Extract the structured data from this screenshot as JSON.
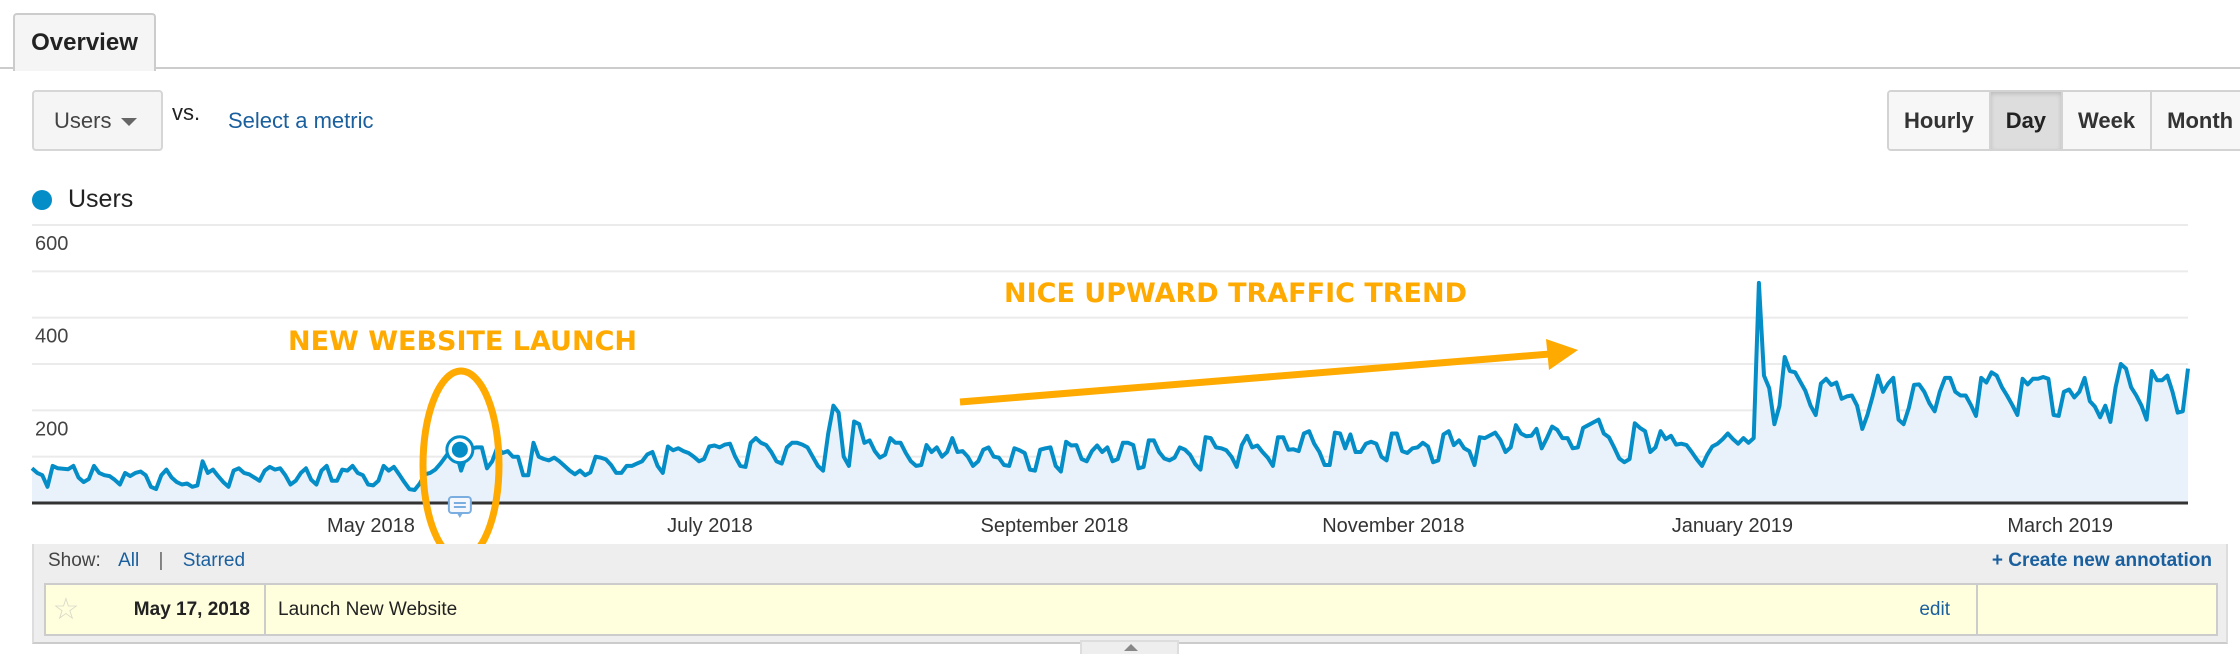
{
  "tabs": [
    {
      "label": "Overview",
      "active": true
    }
  ],
  "metric_selector": {
    "value": "Users",
    "vs_label": "vs.",
    "secondary_link": "Select a metric"
  },
  "time_buttons": [
    {
      "label": "Hourly",
      "active": false
    },
    {
      "label": "Day",
      "active": true
    },
    {
      "label": "Week",
      "active": false
    },
    {
      "label": "Month",
      "active": false
    }
  ],
  "legend": {
    "label": "Users",
    "color": "#058dc7"
  },
  "callouts": {
    "launch": "NEW WEBSITE LAUNCH",
    "trend": "NICE UPWARD TRAFFIC TREND",
    "color": "#ffaa00"
  },
  "annotations": {
    "show_label": "Show:",
    "filter_all": "All",
    "filter_separator": "|",
    "filter_starred": "Starred",
    "create_label": "+ Create new annotation",
    "items": [
      {
        "date": "May 17, 2018",
        "text": "Launch New Website",
        "edit_label": "edit",
        "starred": false
      }
    ]
  },
  "chart_data": {
    "type": "area",
    "title": "",
    "series": [
      {
        "name": "Users",
        "color": "#058dc7"
      }
    ],
    "ylim": [
      0,
      600
    ],
    "yticks": [
      200,
      400,
      600
    ],
    "xtick_labels": [
      "May 2018",
      "July 2018",
      "September 2018",
      "November 2018",
      "January 2019",
      "March 2019"
    ],
    "grid": true,
    "start_date": "2018-03-01",
    "end_date": "2019-03-24",
    "highlight_point": {
      "date": "2018-05-17",
      "value": 115
    },
    "values": [
      75,
      65,
      60,
      35,
      80,
      75,
      74,
      73,
      80,
      55,
      45,
      52,
      80,
      65,
      60,
      58,
      50,
      40,
      65,
      58,
      65,
      68,
      60,
      35,
      30,
      60,
      72,
      55,
      45,
      40,
      42,
      35,
      38,
      90,
      65,
      72,
      58,
      45,
      35,
      70,
      75,
      65,
      62,
      55,
      48,
      70,
      78,
      72,
      75,
      60,
      40,
      48,
      65,
      75,
      50,
      40,
      70,
      80,
      48,
      48,
      72,
      70,
      80,
      65,
      60,
      40,
      38,
      48,
      80,
      70,
      78,
      62,
      45,
      30,
      28,
      42,
      62,
      65,
      72,
      85,
      100,
      115,
      110,
      70,
      102,
      118,
      120,
      120,
      75,
      90,
      120,
      108,
      112,
      100,
      100,
      60,
      60,
      130,
      100,
      95,
      92,
      98,
      90,
      80,
      70,
      62,
      70,
      60,
      66,
      100,
      98,
      94,
      82,
      65,
      65,
      80,
      80,
      85,
      90,
      105,
      110,
      80,
      65,
      122,
      114,
      118,
      112,
      108,
      100,
      90,
      95,
      122,
      124,
      120,
      126,
      128,
      100,
      80,
      78,
      130,
      140,
      130,
      125,
      110,
      90,
      85,
      120,
      130,
      130,
      126,
      120,
      100,
      80,
      70,
      150,
      210,
      195,
      100,
      80,
      176,
      170,
      130,
      135,
      112,
      98,
      104,
      140,
      130,
      130,
      108,
      90,
      80,
      82,
      125,
      110,
      120,
      100,
      110,
      140,
      110,
      112,
      100,
      80,
      90,
      115,
      120,
      100,
      98,
      82,
      80,
      118,
      114,
      108,
      72,
      70,
      115,
      118,
      120,
      80,
      68,
      132,
      124,
      125,
      95,
      90,
      112,
      124,
      110,
      120,
      90,
      95,
      130,
      130,
      125,
      75,
      78,
      135,
      135,
      110,
      96,
      92,
      98,
      120,
      115,
      104,
      84,
      72,
      142,
      140,
      120,
      118,
      114,
      100,
      78,
      125,
      145,
      120,
      124,
      110,
      98,
      80,
      142,
      142,
      115,
      116,
      112,
      150,
      155,
      128,
      110,
      82,
      82,
      152,
      150,
      118,
      148,
      110,
      110,
      128,
      132,
      128,
      100,
      92,
      150,
      150,
      112,
      108,
      118,
      120,
      130,
      122,
      88,
      92,
      148,
      155,
      125,
      135,
      118,
      112,
      82,
      142,
      140,
      146,
      152,
      136,
      110,
      120,
      168,
      150,
      144,
      145,
      160,
      118,
      140,
      165,
      158,
      140,
      140,
      118,
      120,
      162,
      168,
      174,
      180,
      150,
      142,
      120,
      96,
      88,
      95,
      172,
      162,
      155,
      110,
      120,
      155,
      138,
      145,
      126,
      128,
      125,
      110,
      94,
      80,
      104,
      122,
      128,
      138,
      150,
      138,
      128,
      140,
      130,
      140,
      475,
      275,
      248,
      170,
      210,
      315,
      285,
      282,
      262,
      242,
      210,
      190,
      258,
      268,
      255,
      260,
      225,
      230,
      232,
      210,
      160,
      190,
      230,
      275,
      240,
      258,
      270,
      180,
      170,
      205,
      255,
      256,
      240,
      215,
      198,
      240,
      270,
      270,
      240,
      232,
      232,
      212,
      188,
      270,
      260,
      282,
      275,
      250,
      232,
      212,
      190,
      268,
      256,
      268,
      268,
      272,
      268,
      190,
      188,
      240,
      245,
      228,
      240,
      270,
      220,
      208,
      185,
      210,
      175,
      250,
      300,
      290,
      250,
      232,
      210,
      180,
      285,
      265,
      265,
      275,
      240,
      195,
      198,
      290
    ]
  }
}
